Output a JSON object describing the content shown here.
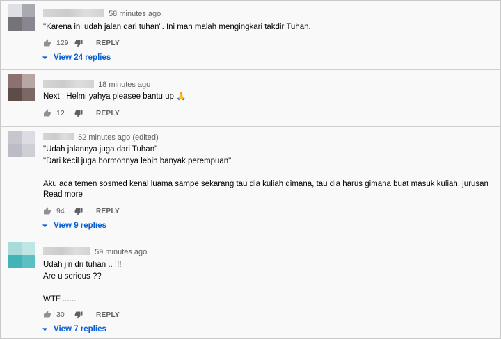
{
  "comments": [
    {
      "time": "58 minutes ago",
      "lines": [
        "\"Karena ini udah jalan dari tuhan\". Ini mah malah mengingkari takdir Tuhan."
      ],
      "likes": "129",
      "reply_label": "REPLY",
      "view_replies": "View 24 replies",
      "avatar_colors": [
        "#dfe0e4",
        "#a9aab0",
        "#757278",
        "#8a8690"
      ]
    },
    {
      "time": "18 minutes ago",
      "lines": [
        "Next : Helmi yahya pleasee bantu up 🙏"
      ],
      "likes": "12",
      "reply_label": "REPLY",
      "avatar_colors": [
        "#8c726e",
        "#b8a6a3",
        "#5d4c4a",
        "#7b6764"
      ]
    },
    {
      "time": "52 minutes ago (edited)",
      "lines": [
        "\"Udah jalannya juga dari Tuhan\"",
        "\"Dari kecil juga hormonnya lebih banyak perempuan\"",
        "",
        "Aku ada temen sosmed kenal luama sampe sekarang tau dia kuliah dimana, tau dia harus gimana buat masuk kuliah, jurusan"
      ],
      "read_more": "Read more",
      "likes": "94",
      "reply_label": "REPLY",
      "view_replies": "View 9 replies",
      "avatar_colors": [
        "#c7c6ce",
        "#dcdce2",
        "#bcbcc6",
        "#cfcfd6"
      ]
    },
    {
      "time": "59 minutes ago",
      "lines": [
        "Udah jln dri tuhan .. !!!",
        "Are u serious ??",
        "",
        "WTF ......"
      ],
      "likes": "30",
      "reply_label": "REPLY",
      "view_replies": "View 7 replies",
      "avatar_colors": [
        "#a7dcdb",
        "#bfe6e4",
        "#42b3b6",
        "#5cc0c2"
      ]
    }
  ],
  "icons": {
    "like": "thumbs-up-icon",
    "dislike": "thumbs-down-icon",
    "expand": "caret-down-icon"
  },
  "colors": {
    "link_blue": "#065fd4",
    "meta_gray": "#606060",
    "text": "#030303"
  }
}
